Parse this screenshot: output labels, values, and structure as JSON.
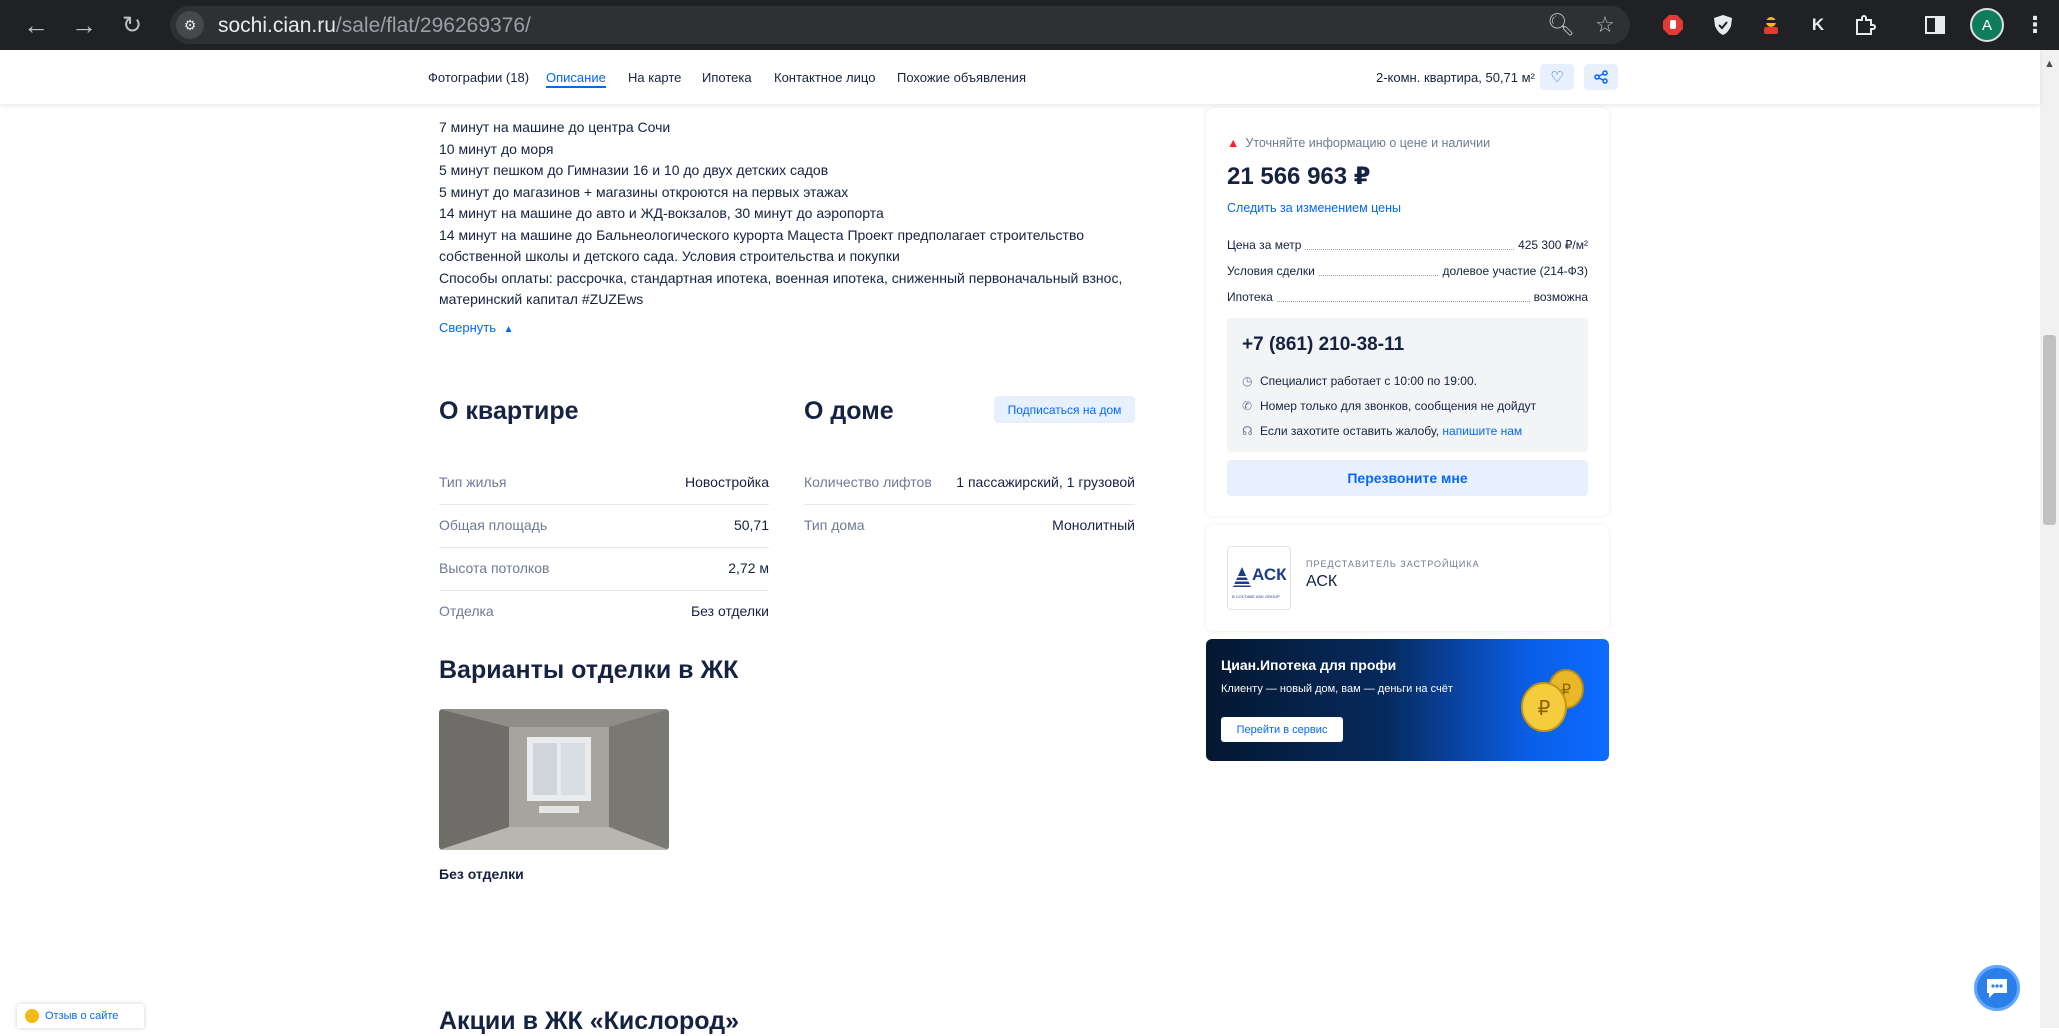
{
  "browser": {
    "url_host": "sochi.cian.ru",
    "url_path": "/sale/flat/296269376/",
    "profile_initial": "A"
  },
  "tabs": {
    "items": [
      {
        "label": "Фотографии (18)"
      },
      {
        "label": "Описание",
        "active": true
      },
      {
        "label": "На карте"
      },
      {
        "label": "Ипотека"
      },
      {
        "label": "Контактное лицо"
      },
      {
        "label": "Похожие объявления"
      }
    ],
    "summary": "2-комн. квартира, 50,71 м²"
  },
  "description": {
    "lines": [
      " 7 минут на машине до центра Сочи",
      " 10 минут до моря",
      " 5 минут пешком до Гимназии 16 и 10 до двух детских садов",
      " 5 минут до магазинов + магазины откроются на первых этажах",
      " 14 минут на машине до авто и ЖД-вокзалов, 30 минут до аэропорта",
      " 14 минут на машине до Бальнеологического курорта Мацеста Проект предполагает строительство",
      "собственной школы и детского сада. Условия строительства и покупки",
      " Способы оплаты: рассрочка, стандартная ипотека, военная ипотека, сниженный первоначальный взнос,",
      "материнский капитал #ZUZEws"
    ],
    "collapse_label": "Свернуть"
  },
  "flat": {
    "title": "О квартире",
    "rows": [
      {
        "label": "Тип жилья",
        "value": "Новостройка"
      },
      {
        "label": "Общая площадь",
        "value": "50,71"
      },
      {
        "label": "Высота потолков",
        "value": "2,72 м"
      },
      {
        "label": "Отделка",
        "value": "Без отделки"
      }
    ]
  },
  "house": {
    "title": "О доме",
    "subscribe_label": "Подписаться на дом",
    "rows": [
      {
        "label": "Количество лифтов",
        "value": "1 пассажирский, 1 грузовой"
      },
      {
        "label": "Тип дома",
        "value": "Монолитный"
      }
    ]
  },
  "finishing": {
    "title": "Варианты отделки в ЖК",
    "item_label": "Без отделки"
  },
  "promotions": {
    "title": "Акции в ЖК «Кислород»"
  },
  "price_card": {
    "warning": "Уточняйте информацию о цене и наличии",
    "price": "21 566 963 ₽",
    "track_link": "Следить за изменением цены",
    "facts": [
      {
        "label": "Цена за метр",
        "value": "425 300 ₽/м²"
      },
      {
        "label": "Условия сделки",
        "value": "долевое участие (214-ФЗ)"
      },
      {
        "label": "Ипотека",
        "value": "возможна"
      }
    ],
    "phone": "+7 (861) 210-38-11",
    "hours": "Специалист работает с 10:00 по 19:00.",
    "calls_only": "Номер только для звонков, сообщения не дойдут",
    "complaint_prefix": "Если захотите оставить жалобу,",
    "complaint_link": "напишите нам",
    "callback_label": "Перезвоните мне"
  },
  "developer": {
    "role": "ПРЕДСТАВИТЕЛЬ ЗАСТРОЙЩИКА",
    "name": "АСК",
    "logo_text": "АСК",
    "logo_small": "В СОСТАВЕ ASK GROUP"
  },
  "ad": {
    "title": "Циан.Ипотека для профи",
    "text": "Клиенту — новый дом, вам — деньги на счёт",
    "button": "Перейти в сервис"
  },
  "feedback_label": "Отзыв о сайте",
  "colors": {
    "accent": "#0468ff",
    "text": "#152242",
    "muted": "#707a95",
    "warning": "#ff1f34"
  }
}
